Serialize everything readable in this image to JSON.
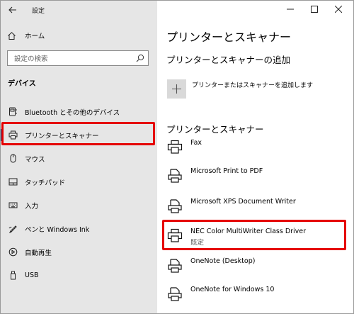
{
  "window": {
    "title": "設定"
  },
  "sidebar": {
    "home_label": "ホーム",
    "search": {
      "placeholder": "設定の検索"
    },
    "section_title": "デバイス",
    "items": [
      {
        "label": "Bluetooth とその他のデバイス",
        "icon": "keyboard-icon"
      },
      {
        "label": "プリンターとスキャナー",
        "icon": "printer-icon",
        "selected": true
      },
      {
        "label": "マウス",
        "icon": "mouse-icon"
      },
      {
        "label": "タッチパッド",
        "icon": "touchpad-icon"
      },
      {
        "label": "入力",
        "icon": "keyboard-icon"
      },
      {
        "label": "ペンと Windows Ink",
        "icon": "pen-icon"
      },
      {
        "label": "自動再生",
        "icon": "autoplay-icon"
      },
      {
        "label": "USB",
        "icon": "usb-icon"
      }
    ]
  },
  "main": {
    "title": "プリンターとスキャナー",
    "add_section_title": "プリンターとスキャナーの追加",
    "add_label": "プリンターまたはスキャナーを追加します",
    "list_section_title": "プリンターとスキャナー",
    "printers": [
      {
        "name": "Fax",
        "status": ""
      },
      {
        "name": "Microsoft Print to PDF",
        "status": ""
      },
      {
        "name": "Microsoft XPS Document Writer",
        "status": ""
      },
      {
        "name": "NEC Color MultiWriter Class Driver",
        "status": "既定"
      },
      {
        "name": "OneNote (Desktop)",
        "status": ""
      },
      {
        "name": "OneNote for Windows 10",
        "status": ""
      }
    ]
  },
  "colors": {
    "accent": "#0063b1",
    "highlight": "#e50000",
    "sidebar_bg": "#e6e6e6"
  }
}
